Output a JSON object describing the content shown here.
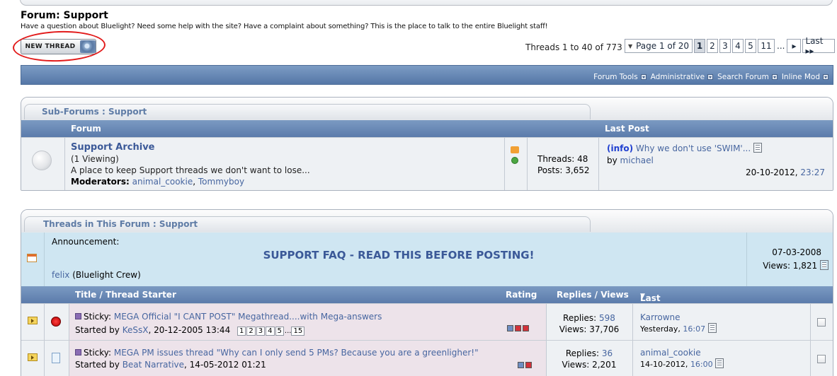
{
  "header": {
    "forum_title": "Forum: Support",
    "forum_description": "Have a question about Bluelight? Need some help with the site? Have a complaint about something? This is the place to talk to the entire Bluelight staff!",
    "new_thread_label": "NEW THREAD",
    "threads_count": "Threads 1 to 40 of 773"
  },
  "pager": {
    "page_label": "Page 1 of 20",
    "pages": [
      "1",
      "2",
      "3",
      "4",
      "5",
      "11"
    ],
    "current": "1",
    "ellipsis": "...",
    "next": "▸",
    "last": "Last ▸▸"
  },
  "toolbar": {
    "items": [
      "Forum Tools",
      "Administrative",
      "Search Forum",
      "Inline Mod"
    ]
  },
  "subforums": {
    "panel_title": "Sub-Forums : Support",
    "col_forum": "Forum",
    "col_last_post": "Last Post",
    "row": {
      "name": "Support Archive",
      "viewing": "(1 Viewing)",
      "description": "A place to keep Support threads we don't want to lose...",
      "moderators_label": "Moderators:",
      "moderator_1": "animal_cookie",
      "moderator_sep": ", ",
      "moderator_2": "Tommyboy",
      "threads": "Threads: 48",
      "posts": "Posts: 3,652",
      "last_post_prefix": "(info)",
      "last_post_title": "Why we don't use 'SWIM'...",
      "by_label": "by",
      "last_post_user": "michael",
      "last_post_date": "20-10-2012,",
      "last_post_time": "23:27"
    }
  },
  "threads": {
    "panel_title": "Threads in This Forum : Support",
    "announcement": {
      "label": "Announcement:",
      "title": "SUPPORT FAQ - READ THIS BEFORE POSTING!",
      "user": "felix",
      "user_role": "(Bluelight Crew)",
      "date": "07-03-2008",
      "views": "Views: 1,821"
    },
    "columns": {
      "title": "Title / Thread Starter",
      "rating": "Rating",
      "replies_views": "Replies / Views",
      "last_post_by": "Last Post By"
    },
    "rows": [
      {
        "prefix": "Sticky:",
        "title": "MEGA Official \"I CANT POST\" Megathread....with Mega-answers",
        "started_label": "Started by",
        "starter": "KeSsX",
        "date": ", 20-12-2005 13:44",
        "pages": [
          "1",
          "2",
          "3",
          "4",
          "5",
          "15"
        ],
        "pages_ellipsis": "...",
        "replies_label": "Replies:",
        "replies": "598",
        "views": "Views: 37,706",
        "last_user": "Karrowne",
        "last_date": "Yesterday,",
        "last_time": "16:07"
      },
      {
        "prefix": "Sticky:",
        "title": "MEGA PM issues thread \"Why can I only send 5 PMs? Because you are a greenligher!\"",
        "started_label": "Started by",
        "starter": "Beat Narrative",
        "date": ", 14-05-2012 01:21",
        "replies_label": "Replies:",
        "replies": "36",
        "views": "Views: 2,201",
        "last_user": "animal_cookie",
        "last_date": "14-10-2012,",
        "last_time": "16:00"
      }
    ]
  },
  "colors": {
    "link": "#4766a0",
    "header_blue": "#5b7bab",
    "annotation_red": "#e21b1b",
    "announcement_bg": "#cfe6f2"
  }
}
